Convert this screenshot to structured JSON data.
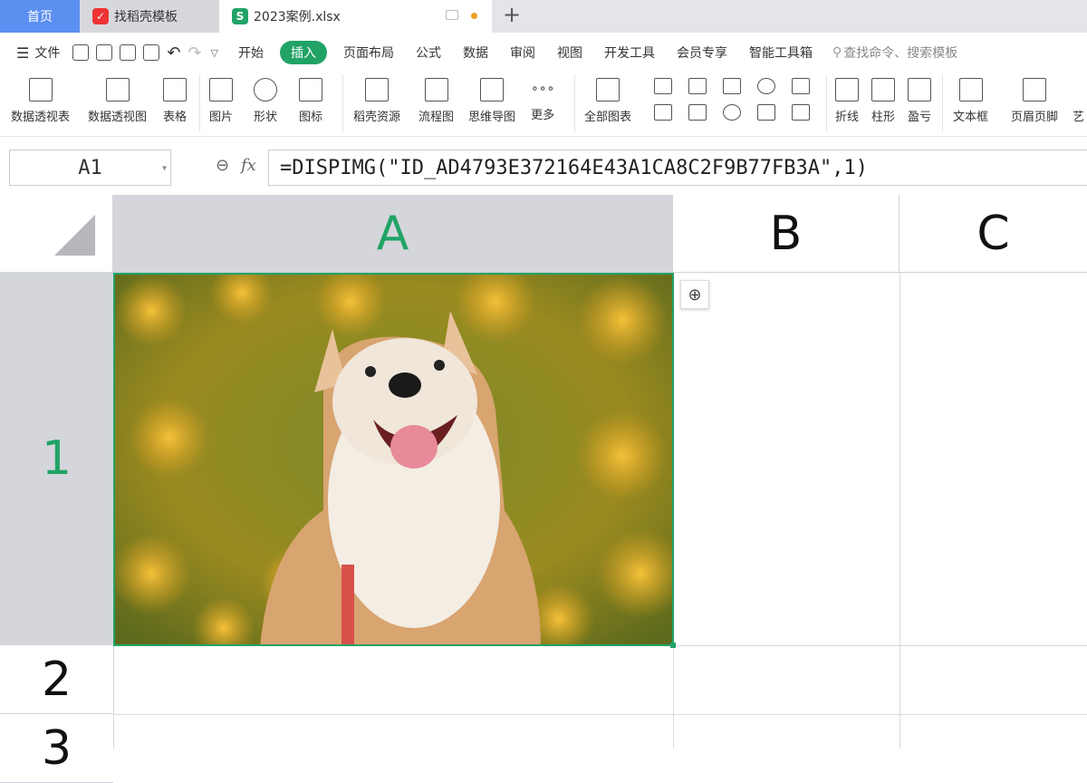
{
  "tabs": [
    {
      "label": "首页"
    },
    {
      "label": "找稻壳模板"
    },
    {
      "label": "2023案例.xlsx"
    }
  ],
  "menu": {
    "file": "文件",
    "items": [
      "开始",
      "插入",
      "页面布局",
      "公式",
      "数据",
      "审阅",
      "视图",
      "开发工具",
      "会员专享",
      "智能工具箱"
    ],
    "active": "插入",
    "search_placeholder": "查找命令、搜索模板"
  },
  "ribbon": [
    "数据透视表",
    "数据透视图",
    "表格",
    "图片",
    "形状",
    "图标",
    "稻壳资源",
    "流程图",
    "思维导图",
    "更多",
    "全部图表",
    "折线",
    "柱形",
    "盈亏",
    "文本框",
    "页眉页脚",
    "艺"
  ],
  "formula_bar": {
    "cell_ref": "A1",
    "fx": "fx",
    "formula": "=DISPIMG(\"ID_AD4793E372164E43A1CA8C2F9B77FB3A\",1)"
  },
  "columns": [
    "A",
    "B",
    "C"
  ],
  "rows": [
    "1",
    "2",
    "3"
  ],
  "colors": {
    "accent": "#21a366",
    "home_tab": "#5b8ff0"
  }
}
